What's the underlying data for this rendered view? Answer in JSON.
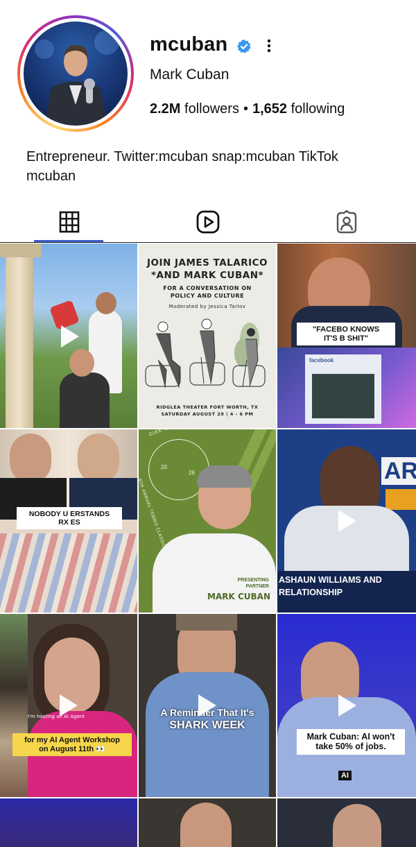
{
  "profile": {
    "username": "mcuban",
    "full_name": "Mark Cuban",
    "followers_count": "2.2M",
    "followers_label": "followers",
    "following_count": "1,652",
    "following_label": "following",
    "bio": "Entrepreneur. Twitter:mcuban snap:mcuban TikTok mcuban"
  },
  "colors": {
    "verified_badge": "#3897f0",
    "tab_underline": "#3d5dc9",
    "avatar_ring": [
      "#feda75",
      "#fa7e1e",
      "#d62976",
      "#962fbf",
      "#4f5bd5"
    ]
  },
  "tabs": [
    {
      "name": "posts",
      "icon": "grid-icon",
      "active": true
    },
    {
      "name": "reels",
      "icon": "reels-play-icon",
      "active": false
    },
    {
      "name": "tagged",
      "icon": "tagged-person-icon",
      "active": false
    }
  ],
  "posts": [
    {
      "type": "reel",
      "text": ""
    },
    {
      "type": "post",
      "title_line1": "JOIN JAMES TALARICO",
      "title_line2": "*AND MARK CUBAN*",
      "sub1": "FOR A CONVERSATION ON",
      "sub2": "POLICY AND CULTURE",
      "moderator": "Moderated by Jessica Tarlov",
      "venue": "RIDGLEA THEATER FORT WORTH, TX",
      "date": "SATURDAY AUGUST 29 | 4 - 6 PM"
    },
    {
      "type": "post",
      "caption_line1": "\"FACEBO   KNOWS",
      "caption_line2": "IT'S B    SHIT\"",
      "screen_label": "facebook"
    },
    {
      "type": "post",
      "caption_line1": "NOBODY U   ERSTANDS",
      "caption_line2": "RX      ES"
    },
    {
      "type": "post",
      "arc_text": "DIRK NOWITZKI FOUNDATION",
      "year_left": "20",
      "year_right": "26",
      "arc_text2": "8TH ANNUAL TENNIS CLASSIC",
      "presenting1": "PRESENTING",
      "presenting2": "PARTNER",
      "presenter": "MARK CUBAN"
    },
    {
      "type": "reel",
      "banner_line1": "ASHAUN WILLIAMS AND",
      "banner_line2": "RELATIONSHIP"
    },
    {
      "type": "reel",
      "small_text": "I'm hosting an AI Agent",
      "caption_line1": "for my AI Agent Workshop",
      "caption_line2": "on August 11th 👀"
    },
    {
      "type": "reel",
      "overlay_line1": "A Reminder That It's",
      "overlay_line2": "SHARK WEEK"
    },
    {
      "type": "reel",
      "caption_line1": "Mark Cuban: AI won't",
      "caption_line2": "take 50% of jobs.",
      "tag": "AI"
    }
  ]
}
